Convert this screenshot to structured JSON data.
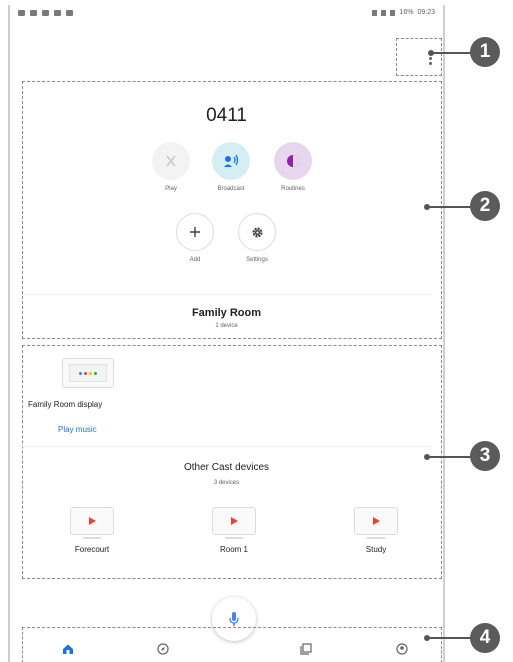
{
  "status_bar": {
    "battery": "16%",
    "time": "09:23"
  },
  "home": {
    "name": "0411"
  },
  "actions": [
    {
      "label": "Play",
      "icon": "play-icon"
    },
    {
      "label": "Broadcast",
      "icon": "broadcast-icon"
    },
    {
      "label": "Routines",
      "icon": "routines-icon"
    }
  ],
  "actions2": [
    {
      "label": "Add",
      "icon": "add-icon"
    },
    {
      "label": "Settings",
      "icon": "gear-icon"
    }
  ],
  "room": {
    "title": "Family Room",
    "subtitle": "1 device",
    "device_name": "Family Room display",
    "play_music": "Play music"
  },
  "other_cast": {
    "title": "Other Cast devices",
    "subtitle": "3 devices",
    "devices": [
      "Forecourt",
      "Room 1",
      "Study"
    ]
  },
  "bottom_nav": [
    "home-icon",
    "discover-icon",
    "media-icon",
    "account-icon"
  ],
  "callouts": [
    "1",
    "2",
    "3",
    "4"
  ],
  "colors": {
    "accent_blue": "#1a73e8",
    "cast_red": "#ea4335",
    "broadcast_bg": "#d4eef4",
    "routines_bg": "#e8d6ef"
  }
}
